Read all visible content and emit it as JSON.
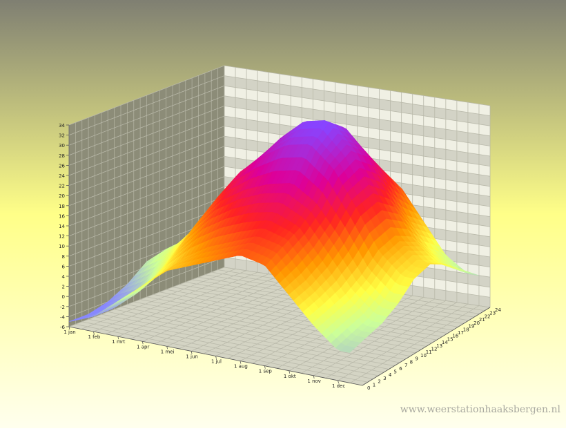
{
  "watermark": "www.weerstationhaaksbergen.nl",
  "colors": {
    "bg_top": "#7f7f72",
    "bg_mid": "#ffff88",
    "bg_bottom": "#ffffee",
    "left_wall": "#8c8c78",
    "back_wall_light": "#f0f0e4",
    "back_wall_dark": "#d3d3c6",
    "floor": "#d4d4c4",
    "grid": "#b9b9aa"
  },
  "chart_data": {
    "type": "surface3d",
    "title": "",
    "xlabel": "",
    "ylabel": "",
    "zlabel": "",
    "x_ticks": [
      "1 jan",
      "1 feb",
      "1 mrt",
      "1 apr",
      "1 mei",
      "1 jun",
      "1 jul",
      "1 aug",
      "1 sep",
      "1 okt",
      "1 nov",
      "1 dec"
    ],
    "y_ticks": [
      "0",
      "1",
      "2",
      "3",
      "4",
      "5",
      "6",
      "7",
      "8",
      "9",
      "10",
      "11",
      "12",
      "13",
      "14",
      "15",
      "16",
      "17",
      "18",
      "19",
      "20",
      "21",
      "22",
      "23",
      "24"
    ],
    "z_ticks": [
      "-6",
      "-4",
      "-2",
      "0",
      "2",
      "4",
      "6",
      "8",
      "10",
      "12",
      "14",
      "16",
      "18",
      "20",
      "22",
      "24",
      "26",
      "28",
      "30",
      "32",
      "34"
    ],
    "zlim": [
      -6,
      34
    ],
    "color_scale": [
      {
        "value": -4,
        "color": "#8888ff"
      },
      {
        "value": 2,
        "color": "#ccff99"
      },
      {
        "value": 6,
        "color": "#ffff44"
      },
      {
        "value": 12,
        "color": "#ff9900"
      },
      {
        "value": 18,
        "color": "#ff2222"
      },
      {
        "value": 24,
        "color": "#dd0099"
      },
      {
        "value": 32,
        "color": "#8844ff"
      }
    ],
    "months": [
      "jan",
      "feb",
      "mrt",
      "apr",
      "mei",
      "jun",
      "jul",
      "aug",
      "sep",
      "okt",
      "nov",
      "dec"
    ],
    "hours": [
      0,
      3,
      6,
      9,
      12,
      15,
      18,
      21,
      24
    ],
    "values": [
      [
        -5,
        -3,
        1,
        5,
        9,
        11,
        13,
        15,
        14,
        9,
        4,
        0
      ],
      [
        -5,
        -3,
        1,
        6,
        10,
        13,
        15,
        17,
        16,
        10,
        5,
        1
      ],
      [
        -4,
        -2,
        3,
        9,
        14,
        17,
        19,
        20,
        18,
        12,
        6,
        2
      ],
      [
        -2,
        1,
        6,
        13,
        18,
        21,
        23,
        24,
        21,
        15,
        8,
        4
      ],
      [
        1,
        4,
        9,
        16,
        22,
        26,
        29,
        30,
        26,
        19,
        11,
        7
      ],
      [
        2,
        5,
        11,
        17,
        23,
        28,
        32,
        33,
        28,
        20,
        12,
        8
      ],
      [
        1,
        4,
        9,
        15,
        21,
        26,
        29,
        30,
        25,
        17,
        10,
        6
      ],
      [
        -1,
        2,
        6,
        11,
        16,
        20,
        23,
        24,
        20,
        12,
        6,
        3
      ],
      [
        -3,
        0,
        3,
        7,
        11,
        15,
        17,
        18,
        15,
        9,
        3,
        0
      ]
    ]
  }
}
